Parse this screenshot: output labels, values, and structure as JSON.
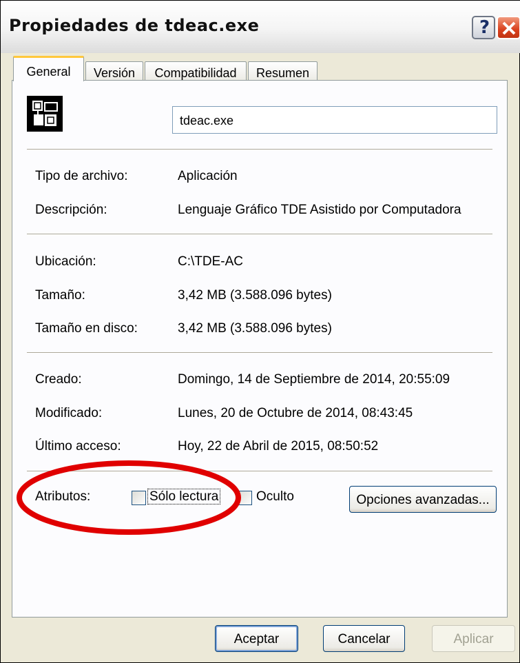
{
  "window": {
    "title": "Propiedades de tdeac.exe"
  },
  "titlebar": {
    "help_label": "?"
  },
  "tabs": [
    {
      "label": "General",
      "active": true
    },
    {
      "label": "Versión",
      "active": false
    },
    {
      "label": "Compatibilidad",
      "active": false
    },
    {
      "label": "Resumen",
      "active": false
    }
  ],
  "general": {
    "file_name": "tdeac.exe",
    "rows": [
      {
        "label": "Tipo de archivo:",
        "value": "Aplicación"
      },
      {
        "label": "Descripción:",
        "value": "Lenguaje Gráfico TDE Asistido por Computadora"
      },
      {
        "label": "Ubicación:",
        "value": "C:\\TDE-AC"
      },
      {
        "label": "Tamaño:",
        "value": "3,42 MB (3.588.096 bytes)"
      },
      {
        "label": "Tamaño en disco:",
        "value": "3,42 MB (3.588.096 bytes)"
      },
      {
        "label": "Creado:",
        "value": "Domingo, 14 de Septiembre de 2014, 20:55:09"
      },
      {
        "label": "Modificado:",
        "value": "Lunes, 20 de Octubre de 2014, 08:43:45"
      },
      {
        "label": "Último acceso:",
        "value": "Hoy, 22 de Abril de 2015, 08:50:52"
      }
    ],
    "attributes": {
      "label": "Atributos:",
      "readonly": {
        "label": "Sólo lectura",
        "checked": false
      },
      "hidden": {
        "label": "Oculto",
        "checked": false
      },
      "advanced_button": "Opciones avanzadas..."
    }
  },
  "buttons": {
    "ok": "Aceptar",
    "cancel": "Cancelar",
    "apply": "Aplicar"
  },
  "colors": {
    "annotation_oval": "#e00000",
    "title_close": "#d9411e",
    "active_tab_accent": "#ffc83c"
  }
}
